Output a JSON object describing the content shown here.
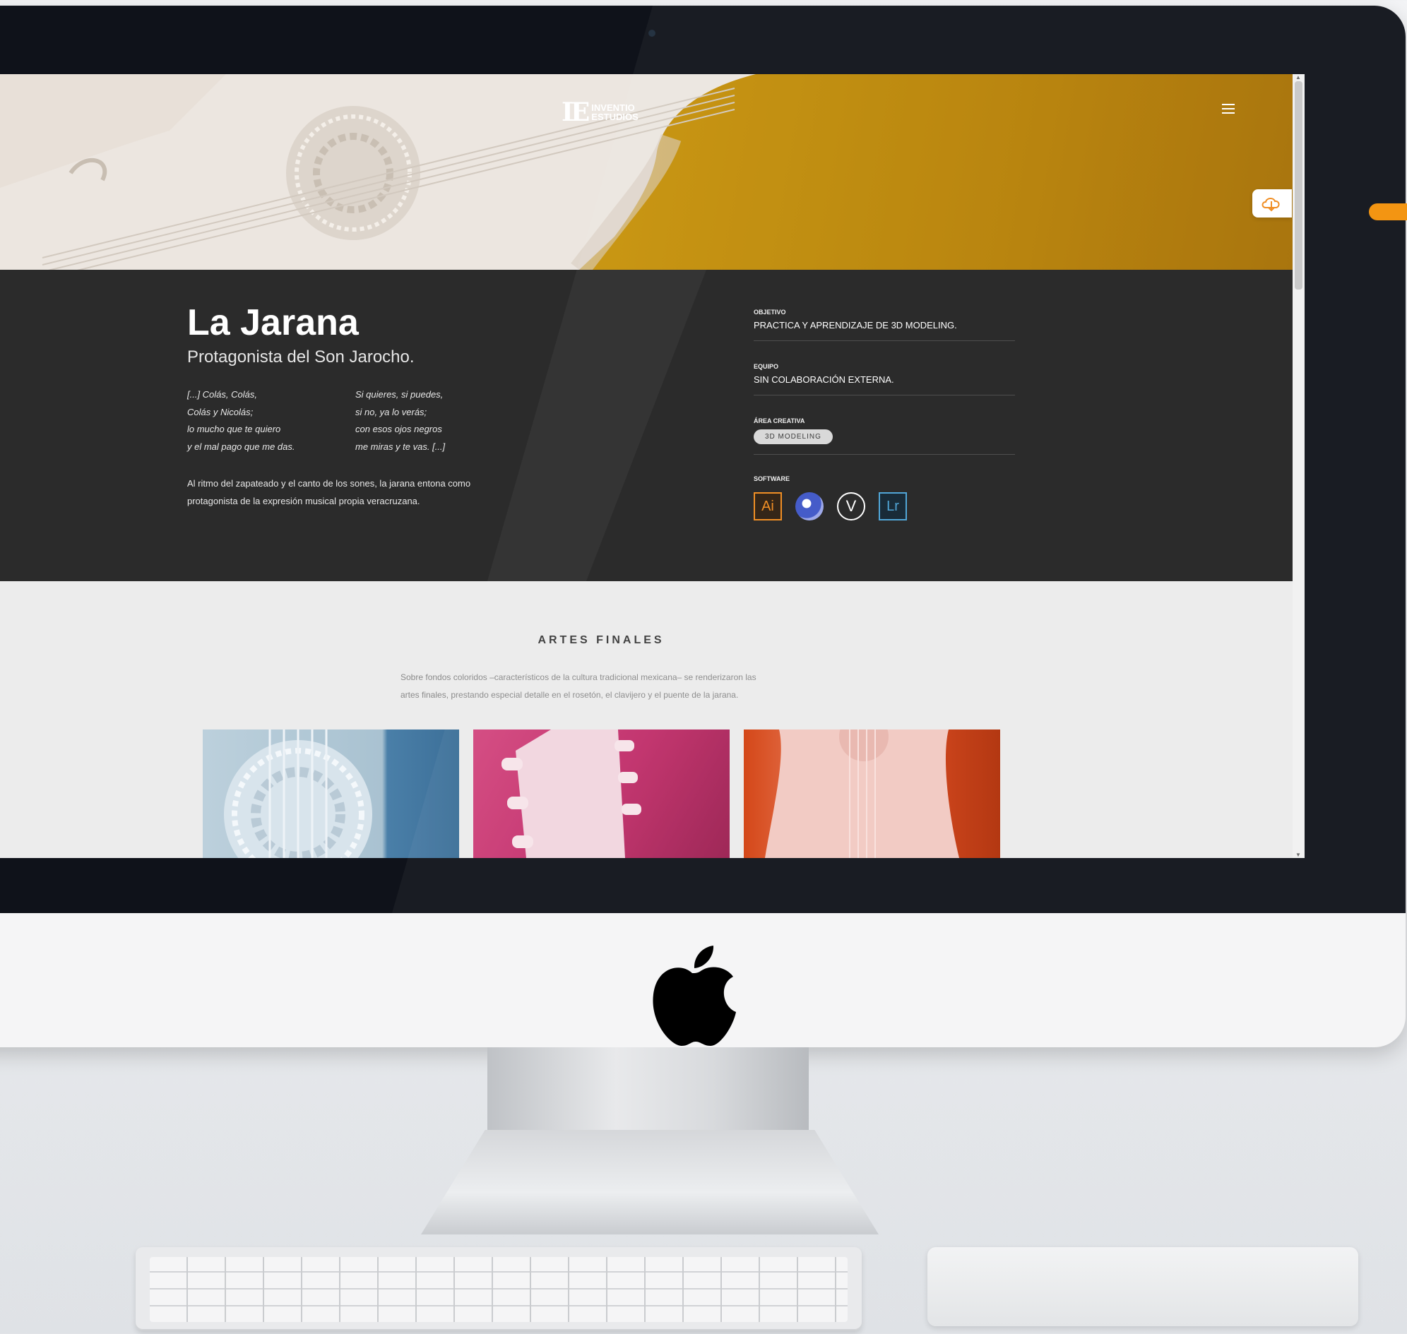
{
  "site": {
    "logo_mark": "IE",
    "logo_text_1": "INVENTIO",
    "logo_text_2": "ESTUDIOS"
  },
  "project": {
    "title": "La Jarana",
    "subtitle": "Protagonista del Son Jarocho.",
    "poem_left": [
      "[...] Colás, Colás,",
      "Colás y Nicolás;",
      "lo mucho que te quiero",
      "y el mal pago que me das."
    ],
    "poem_right": [
      "Si quieres, si puedes,",
      "si no, ya lo verás;",
      "con esos ojos negros",
      "me miras y te vas. [...]"
    ],
    "description": "Al ritmo del zapateado y el canto de los sones, la jarana entona como protagonista de la expresión musical propia veracruzana."
  },
  "meta": {
    "objetivo_label": "OBJETIVO",
    "objetivo_value": "PRACTICA Y APRENDIZAJE DE 3D MODELING.",
    "equipo_label": "EQUIPO",
    "equipo_value": "SIN COLABORACIÓN EXTERNA.",
    "area_label": "ÁREA CREATIVA",
    "area_chip": "3D MODELING",
    "software_label": "SOFTWARE",
    "software": [
      {
        "icon": "adobe-illustrator-icon",
        "text": "Ai"
      },
      {
        "icon": "cinema-4d-icon",
        "text": ""
      },
      {
        "icon": "vray-icon",
        "text": "V"
      },
      {
        "icon": "adobe-lightroom-icon",
        "text": "Lr"
      }
    ]
  },
  "artes": {
    "title": "ARTES FINALES",
    "text_line1": "Sobre fondos coloridos –característicos de la cultura tradicional mexicana– se renderizaron las",
    "text_line2": "artes finales, prestando especial detalle en el rosetón, el clavijero y el puente de la jarana."
  },
  "colors": {
    "hero_gold": "#c9950a",
    "dark_panel": "#2b2b2b",
    "accent_orange": "#f39512"
  }
}
